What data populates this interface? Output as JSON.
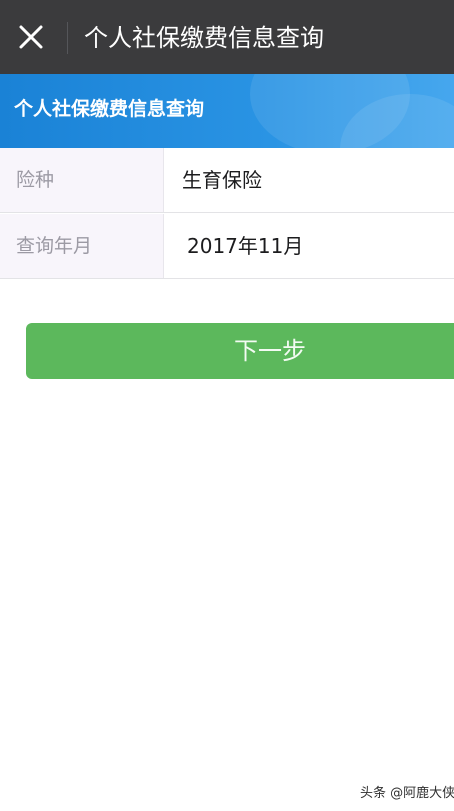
{
  "header": {
    "title": "个人社保缴费信息查询",
    "close_icon": "close-icon"
  },
  "banner": {
    "title": "个人社保缴费信息查询"
  },
  "form": {
    "rows": [
      {
        "label": "险种",
        "value": "生育保险"
      },
      {
        "label": "查询年月",
        "value": "2017年11月"
      }
    ]
  },
  "actions": {
    "next_label": "下一步"
  },
  "watermark": {
    "text": "头条 @阿鹿大侠"
  },
  "colors": {
    "topbar": "#3b3b3d",
    "banner": "#2a94e4",
    "button": "#5cb85c",
    "label_bg": "#f8f5fb"
  }
}
